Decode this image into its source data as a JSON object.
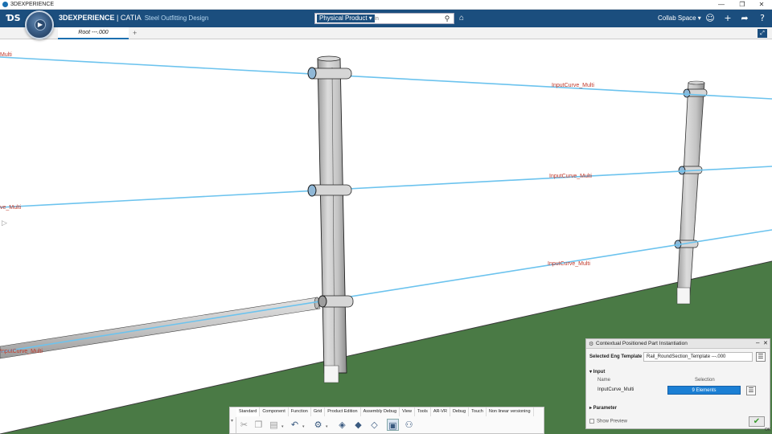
{
  "os_window": {
    "title": "3DEXPERIENCE",
    "controls": [
      "—",
      "❐",
      "✕"
    ]
  },
  "header": {
    "brand_bold": "3DEXPERIENCE",
    "brand_sep": " | ",
    "brand_app": "CATIA",
    "brand_role": "Steel Outfitting Design",
    "search_scope": "Physical Product ▾",
    "search_placeholder": "In",
    "collab_space": "Collab Space ▾",
    "icons": [
      "user-icon",
      "add-icon",
      "share-icon",
      "help-icon",
      "tag-icon",
      "search-icon"
    ]
  },
  "tabs": {
    "root": "Root ---.000",
    "add": "+"
  },
  "viewport": {
    "curve_labels": [
      "Multi",
      "InputCurve_Multi",
      "InputCurve_Multi",
      "InputCurve_Multi",
      "ve_Multi",
      "InputCurve_Multi"
    ],
    "curve_color": "#6cc3ee",
    "ground_color": "#4a7a45"
  },
  "panel": {
    "title": "Contextual Positioned Part Instantiation",
    "template_label": "Selected Eng Template",
    "template_value": "Rail_RoundSection_Template ---.000",
    "input_section": "▾ Input",
    "col_name": "Name",
    "col_selection": "Selection",
    "input_name": "InputCurve_Multi",
    "input_selection": "9 Elements",
    "parameter_section": "▸ Parameter",
    "show_preview": "Show Preview",
    "ok_text": "OK"
  },
  "action_bar": {
    "tabs": [
      "Standard",
      "Component",
      "Function",
      "Grid",
      "Product Edition",
      "Assembly Debug",
      "View",
      "Tools",
      "AR-VR",
      "Debug",
      "Touch",
      "Non linear versioning"
    ],
    "active_tab": "Standard"
  }
}
